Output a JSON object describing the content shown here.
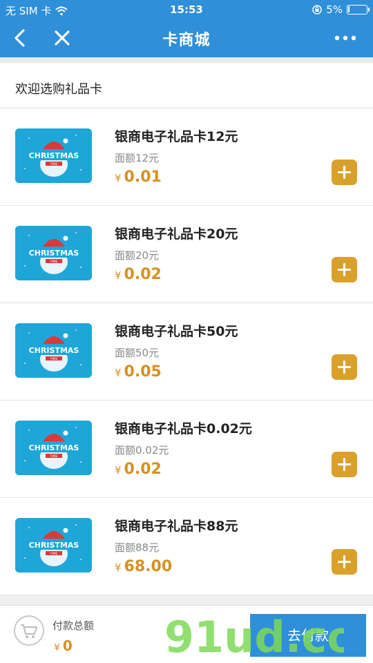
{
  "status": {
    "carrier": "无 SIM 卡",
    "time": "15:53",
    "battery": "5%"
  },
  "nav": {
    "title": "卡商城"
  },
  "welcome": "欢迎选购礼品卡",
  "currency": "¥",
  "items": [
    {
      "name": "银商电子礼品卡12元",
      "face": "面额12元",
      "price": "0.01"
    },
    {
      "name": "银商电子礼品卡20元",
      "face": "面额20元",
      "price": "0.02"
    },
    {
      "name": "银商电子礼品卡50元",
      "face": "面额50元",
      "price": "0.05"
    },
    {
      "name": "银商电子礼品卡0.02元",
      "face": "面额0.02元",
      "price": "0.02"
    },
    {
      "name": "银商电子礼品卡88元",
      "face": "面额88元",
      "price": "68.00"
    }
  ],
  "card_art": {
    "line1": "CHRISTMAS",
    "line2": "TIME"
  },
  "footer": {
    "total_label": "付款总额",
    "total_value": "0",
    "pay_label": "去付款"
  },
  "watermark": {
    "text": "91ud.com"
  },
  "colors": {
    "primary": "#2f8fd8",
    "price": "#d79023",
    "add_button": "#d9a12c"
  }
}
